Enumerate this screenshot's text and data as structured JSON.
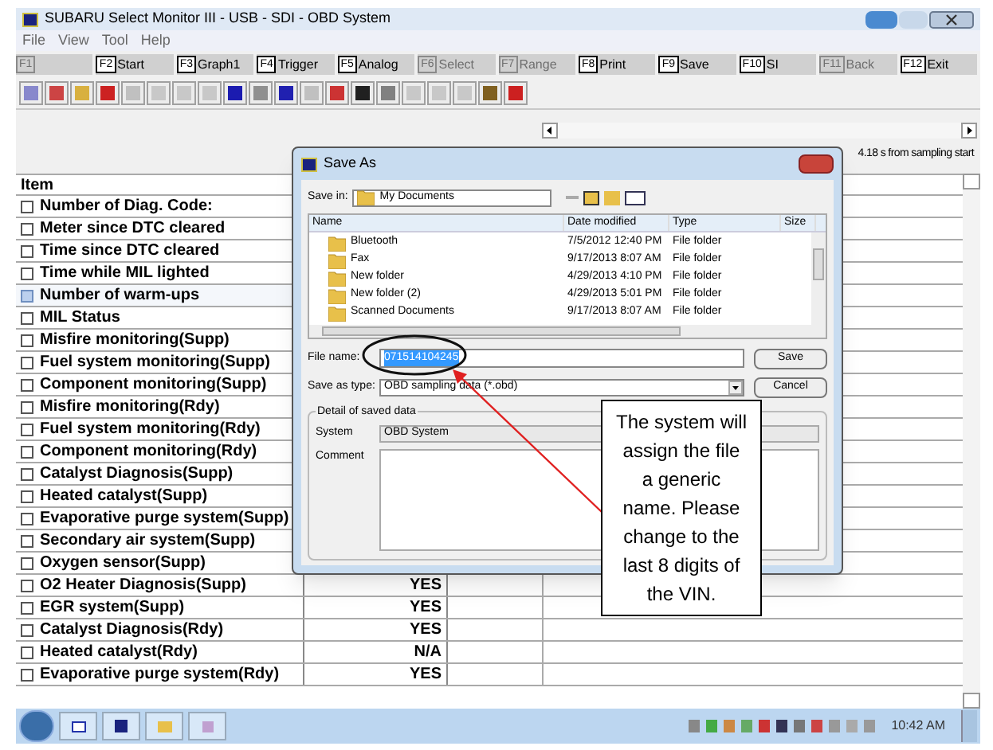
{
  "window": {
    "title": "SUBARU Select Monitor III - USB - SDI - OBD System"
  },
  "menu": [
    "File",
    "View",
    "Tool",
    "Help"
  ],
  "function_keys": [
    {
      "key": "F1",
      "disabled": true
    },
    {
      "key": "F2",
      "label": "Start",
      "disabled": false
    },
    {
      "key": "F3",
      "label": "Graph1",
      "disabled": false
    },
    {
      "key": "F4",
      "label": "Trigger",
      "disabled": false
    },
    {
      "key": "F5",
      "label": "Analog",
      "disabled": false
    },
    {
      "key": "F6",
      "label": "Select",
      "disabled": true
    },
    {
      "key": "F7",
      "label": "Range",
      "disabled": true
    },
    {
      "key": "F8",
      "label": "Print",
      "disabled": false
    },
    {
      "key": "F9",
      "label": "Save",
      "disabled": false
    },
    {
      "key": "F10",
      "label": "SI",
      "disabled": false
    },
    {
      "key": "F11",
      "label": "Back",
      "disabled": true
    },
    {
      "key": "F12",
      "label": "Exit",
      "disabled": false
    }
  ],
  "status": "4.18 s from sampling start",
  "table": {
    "columns": [
      "Item"
    ],
    "rows": [
      {
        "item": "Number of Diag. Code:",
        "selected": false
      },
      {
        "item": "Meter since DTC cleared",
        "selected": false
      },
      {
        "item": "Time since DTC cleared",
        "selected": false
      },
      {
        "item": "Time while MIL lighted",
        "selected": false
      },
      {
        "item": "Number of warm-ups",
        "selected": true
      },
      {
        "item": "MIL Status",
        "selected": false
      },
      {
        "item": "Misfire monitoring(Supp)",
        "selected": false
      },
      {
        "item": "Fuel system monitoring(Supp)",
        "selected": false
      },
      {
        "item": "Component monitoring(Supp)",
        "selected": false
      },
      {
        "item": "Misfire monitoring(Rdy)",
        "selected": false
      },
      {
        "item": "Fuel system monitoring(Rdy)",
        "selected": false
      },
      {
        "item": "Component monitoring(Rdy)",
        "selected": false
      },
      {
        "item": "Catalyst Diagnosis(Supp)",
        "selected": false
      },
      {
        "item": "Heated catalyst(Supp)",
        "selected": false
      },
      {
        "item": "Evaporative purge system(Supp)",
        "selected": false
      },
      {
        "item": "Secondary air system(Supp)",
        "selected": false
      },
      {
        "item": "Oxygen sensor(Supp)",
        "selected": false
      },
      {
        "item": "O2 Heater Diagnosis(Supp)",
        "selected": false,
        "value": "YES"
      },
      {
        "item": "EGR system(Supp)",
        "selected": false,
        "value": "YES"
      },
      {
        "item": "Catalyst Diagnosis(Rdy)",
        "selected": false,
        "value": "YES"
      },
      {
        "item": "Heated catalyst(Rdy)",
        "selected": false,
        "value": "N/A"
      },
      {
        "item": "Evaporative purge system(Rdy)",
        "selected": false,
        "value": "YES"
      }
    ]
  },
  "dialog": {
    "title": "Save As",
    "save_in_label": "Save in:",
    "save_in": "My Documents",
    "columns": [
      "Name",
      "Date modified",
      "Type",
      "Size"
    ],
    "files": [
      {
        "name": "Bluetooth",
        "date": "7/5/2012 12:40 PM",
        "type": "File folder"
      },
      {
        "name": "Fax",
        "date": "9/17/2013 8:07 AM",
        "type": "File folder"
      },
      {
        "name": "New folder",
        "date": "4/29/2013 4:10 PM",
        "type": "File folder"
      },
      {
        "name": "New folder (2)",
        "date": "4/29/2013 5:01 PM",
        "type": "File folder"
      },
      {
        "name": "Scanned Documents",
        "date": "9/17/2013 8:07 AM",
        "type": "File folder"
      }
    ],
    "file_name_label": "File name:",
    "file_name": "071514104245",
    "type_label": "Save as type:",
    "type": "OBD sampling data (*.obd)",
    "buttons": [
      "Save",
      "Cancel"
    ],
    "group_title": "Detail of saved data",
    "system_label": "System",
    "system": "OBD System",
    "comment_label": "Comment"
  },
  "callout": "The system will assign the file a generic name.  Please change to the last 8 digits of the VIN.",
  "taskbar": {
    "time": "10:42 AM"
  }
}
